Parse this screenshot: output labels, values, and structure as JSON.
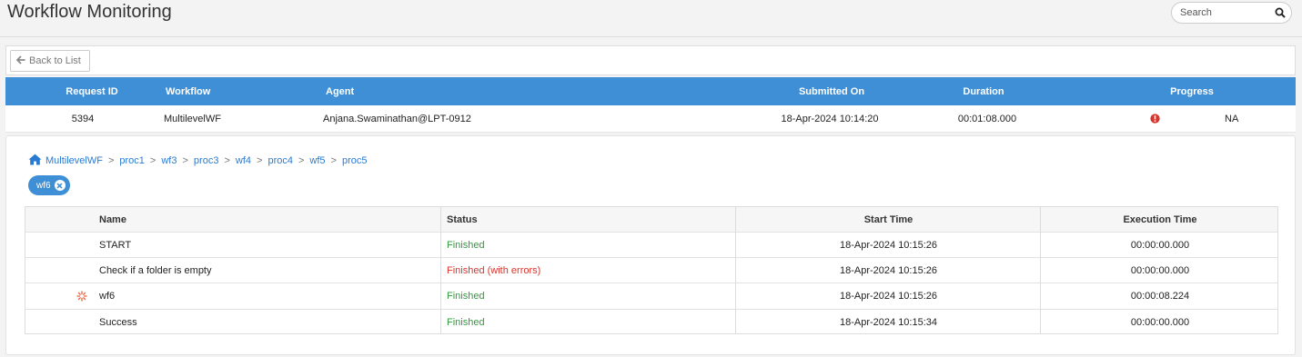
{
  "page": {
    "title": "Workflow Monitoring"
  },
  "search": {
    "placeholder": "Search",
    "icon": "search-icon"
  },
  "toolbar": {
    "back_label": "Back to List",
    "back_icon": "arrow-left-icon"
  },
  "request": {
    "headers": {
      "request_id": "Request ID",
      "workflow": "Workflow",
      "agent": "Agent",
      "submitted_on": "Submitted On",
      "duration": "Duration",
      "progress": "Progress"
    },
    "row": {
      "request_id": "5394",
      "workflow": "MultilevelWF",
      "agent": "Anjana.Swaminathan@LPT-0912",
      "submitted_on": "18-Apr-2024 10:14:20",
      "duration": "00:01:08.000",
      "progress_icon": "error-icon",
      "progress": "NA"
    }
  },
  "breadcrumb": {
    "home_icon": "home-icon",
    "items": [
      "MultilevelWF",
      "proc1",
      "wf3",
      "proc3",
      "wf4",
      "proc4",
      "wf5",
      "proc5"
    ],
    "separator": ">"
  },
  "filter_chip": {
    "label": "wf6",
    "remove_icon": "close-circle-icon"
  },
  "steps": {
    "headers": {
      "name": "Name",
      "status": "Status",
      "start_time": "Start Time",
      "execution_time": "Execution Time"
    },
    "rows": [
      {
        "icon": "",
        "name": "START",
        "status": "Finished",
        "status_kind": "ok",
        "start_time": "18-Apr-2024 10:15:26",
        "execution_time": "00:00:00.000"
      },
      {
        "icon": "",
        "name": "Check if a folder is empty",
        "status": "Finished (with errors)",
        "status_kind": "error",
        "start_time": "18-Apr-2024 10:15:26",
        "execution_time": "00:00:00.000"
      },
      {
        "icon": "subworkflow-icon",
        "name": "wf6",
        "status": "Finished",
        "status_kind": "ok",
        "start_time": "18-Apr-2024 10:15:26",
        "execution_time": "00:00:08.224"
      },
      {
        "icon": "",
        "name": "Success",
        "status": "Finished",
        "status_kind": "ok",
        "start_time": "18-Apr-2024 10:15:34",
        "execution_time": "00:00:00.000"
      }
    ]
  },
  "colors": {
    "header_blue": "#3f8fd6",
    "link_blue": "#2a7ad2",
    "status_ok": "#2f9a3a",
    "status_error": "#d9342b",
    "icon_orange": "#e8603c"
  }
}
